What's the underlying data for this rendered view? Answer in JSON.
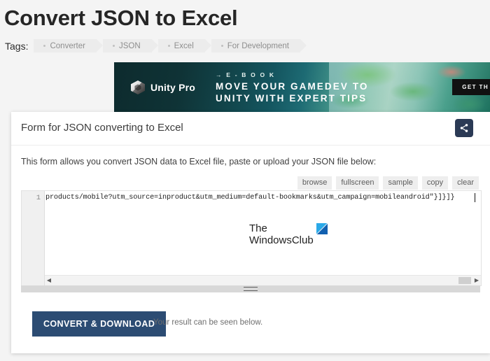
{
  "page": {
    "title": "Convert JSON to Excel",
    "tags_label": "Tags:",
    "tags": [
      {
        "label": "Converter"
      },
      {
        "label": "JSON"
      },
      {
        "label": "Excel"
      },
      {
        "label": "For Development"
      }
    ]
  },
  "ad": {
    "brand": "Unity Pro",
    "eyebrow": "→  E - B O O K",
    "headline_line1": "MOVE YOUR GAMEDEV TO",
    "headline_line2": "UNITY WITH EXPERT TIPS",
    "cta": "GET TH",
    "logo_icon": "unity-cube-icon"
  },
  "card": {
    "title": "Form for JSON converting to Excel",
    "share_icon": "share-icon",
    "description": "This form allows you convert JSON data to Excel file, paste or upload your JSON file below:",
    "toolbar": [
      {
        "label": "browse"
      },
      {
        "label": "fullscreen"
      },
      {
        "label": "sample"
      },
      {
        "label": "copy"
      },
      {
        "label": "clear"
      }
    ],
    "editor": {
      "line_number": "1",
      "code": "products/mobile?utm_source=inproduct&utm_medium=default-bookmarks&utm_campaign=mobileandroid\"}]}]}",
      "scroll_left_arrow": "◀",
      "scroll_right_arrow": "▶"
    },
    "watermark": {
      "line1": "The",
      "line2": "WindowsClub",
      "logo_icon": "windowsclub-logo-icon"
    },
    "convert_button": "CONVERT & DOWNLOAD",
    "result_note": "Your result can be seen below."
  },
  "colors": {
    "page_background": "#f4f4f4",
    "card_background": "#ffffff",
    "convert_button": "#2c4c73",
    "share_button": "#2b3a55",
    "tag_chip": "#ececec",
    "tag_text": "#8e8e8e",
    "watermark_logo": "#2aa9e8"
  }
}
